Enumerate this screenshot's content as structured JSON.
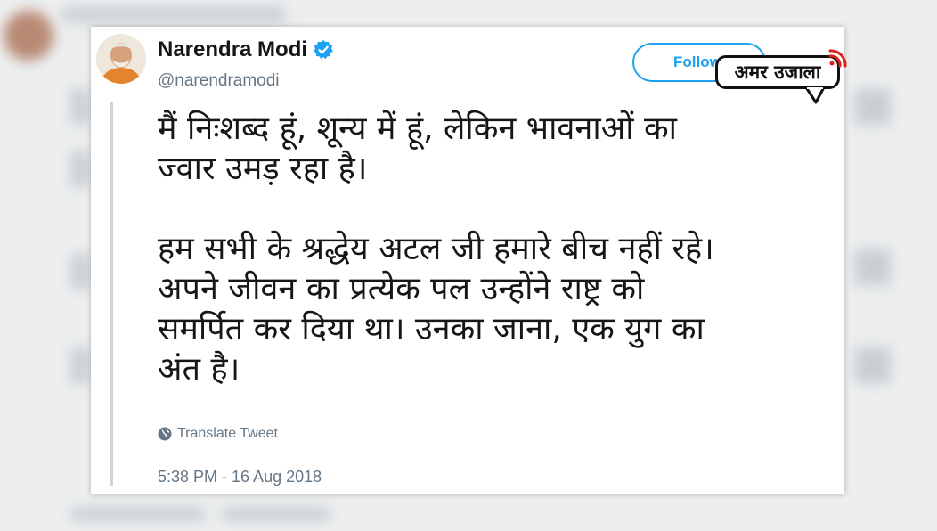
{
  "tweet": {
    "display_name": "Narendra Modi",
    "verified_icon": "verified-badge-icon",
    "handle": "@narendramodi",
    "follow_label": "Follow",
    "text": "मैं निःशब्द हूं, शून्य में हूं, लेकिन भावनाओं का\nज्वार उमड़ रहा है।\n\nहम सभी के श्रद्धेय अटल जी हमारे बीच नहीं रहे।\nअपने जीवन का प्रत्येक पल उन्होंने राष्ट्र को\nसमर्पित कर दिया था। उनका जाना, एक युग का\nअंत है।",
    "translate_label": "Translate Tweet",
    "translate_icon": "globe-icon",
    "timestamp": "5:38 PM - 16 Aug 2018"
  },
  "watermark": {
    "logo_text": "अमर उजाला"
  },
  "colors": {
    "accent": "#1da1f2",
    "text": "#14171a",
    "muted": "#657786",
    "logo_signal": "#e0201b"
  }
}
